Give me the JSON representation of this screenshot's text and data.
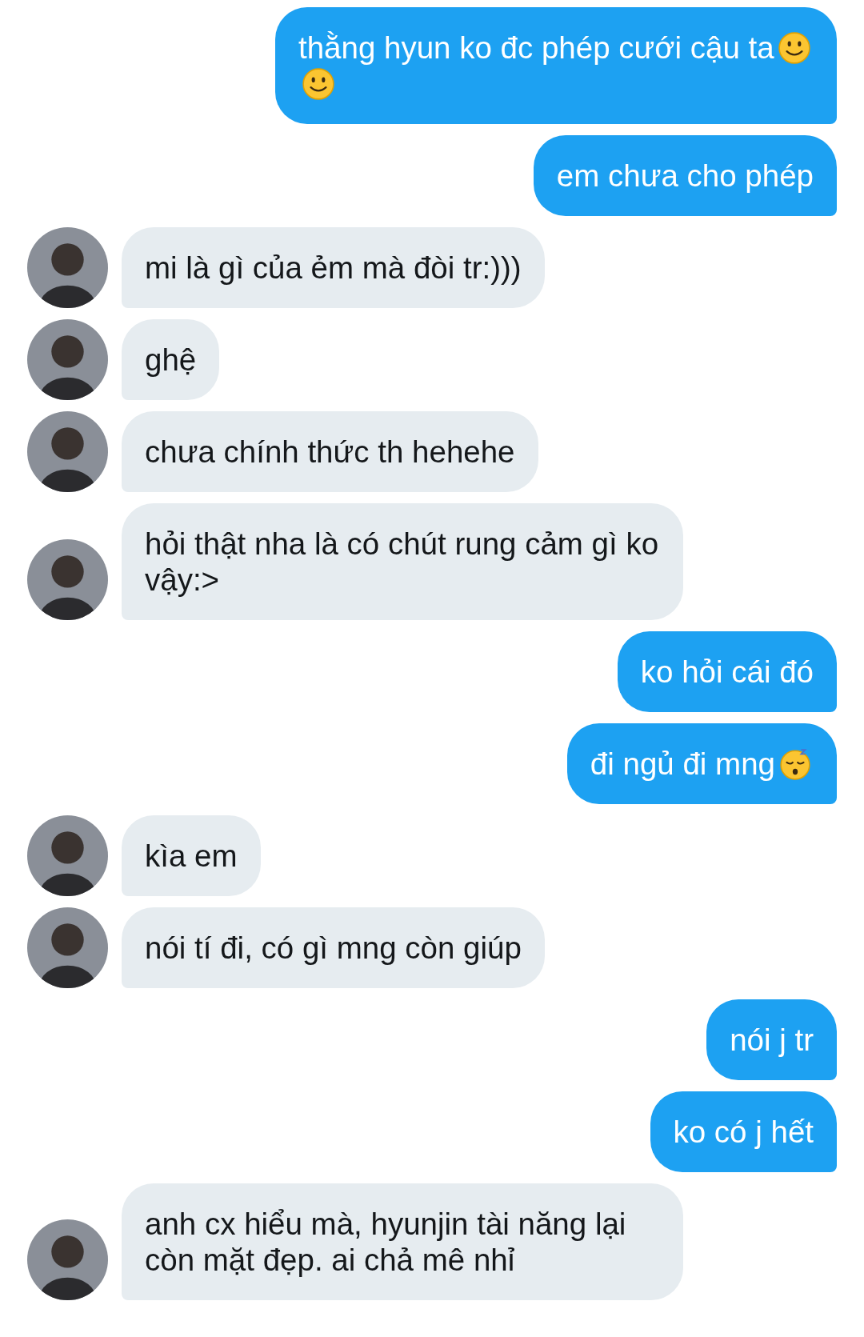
{
  "messages": [
    {
      "outgoing": true,
      "text": "thằng hyun ko đc phép cưới cậu ta",
      "emojis": [
        {
          "kind": "smile"
        },
        {
          "kind": "smile"
        }
      ]
    },
    {
      "outgoing": true,
      "text": "em chưa cho phép"
    },
    {
      "outgoing": false,
      "text": "mi là gì của ẻm mà đòi tr:)))"
    },
    {
      "outgoing": false,
      "text": "ghệ"
    },
    {
      "outgoing": false,
      "text": "chưa chính thức th hehehe"
    },
    {
      "outgoing": false,
      "text": "hỏi thật nha là có chút rung cảm gì ko vậy:>"
    },
    {
      "outgoing": true,
      "text": "ko hỏi cái đó"
    },
    {
      "outgoing": true,
      "text": "đi ngủ đi mng",
      "emojis": [
        {
          "kind": "sleepy"
        }
      ]
    },
    {
      "outgoing": false,
      "text": "kìa em"
    },
    {
      "outgoing": false,
      "text": "nói tí đi, có gì mng còn giúp"
    },
    {
      "outgoing": true,
      "text": "nói j tr"
    },
    {
      "outgoing": true,
      "text": "ko có j hết"
    },
    {
      "outgoing": false,
      "text": "anh cx hiểu mà, hyunjin tài năng lại còn mặt đẹp. ai chả mê nhỉ"
    }
  ]
}
